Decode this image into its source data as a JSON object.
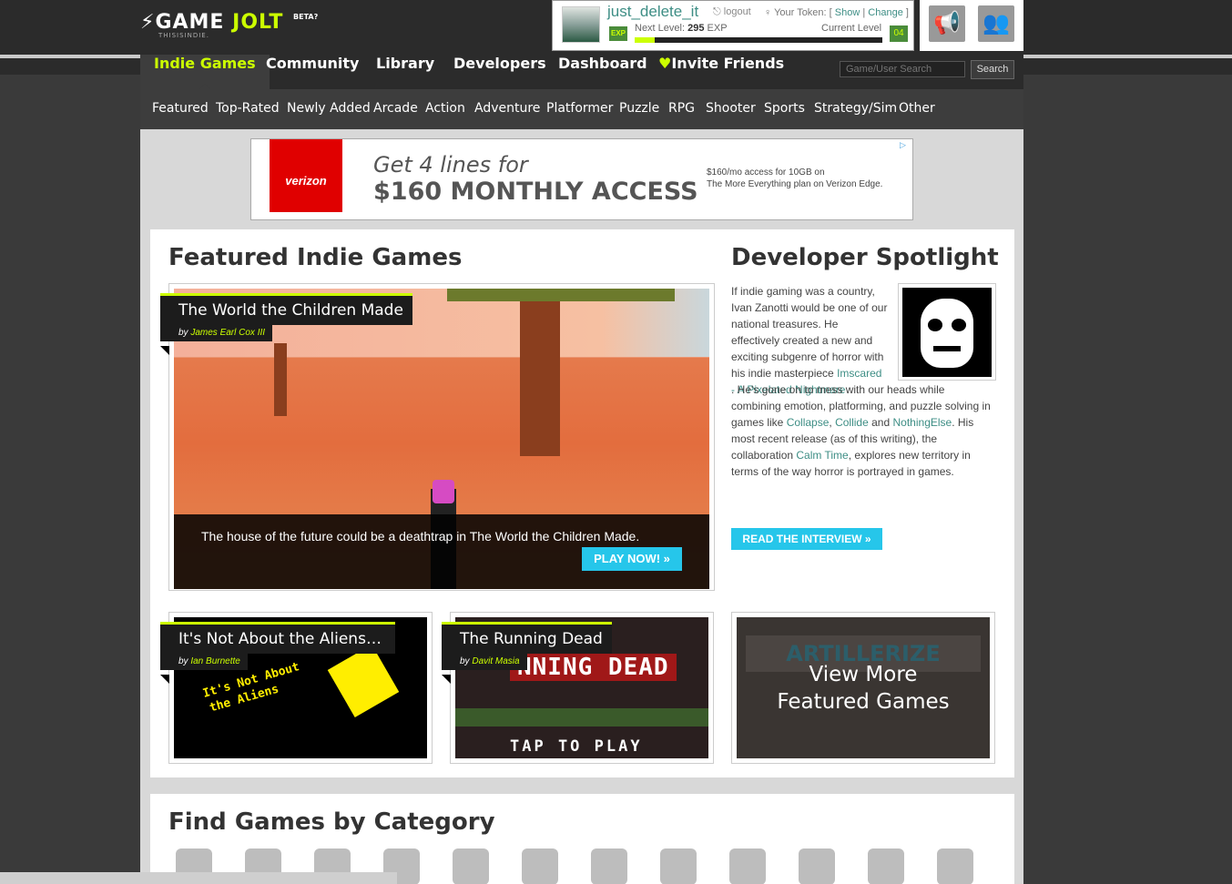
{
  "logo": {
    "text1": "GAME",
    "text2": "JOLT",
    "beta": "BETA?",
    "tagline": "THISISINDIE."
  },
  "user": {
    "name": "just_delete_it",
    "exp_label": "EXP",
    "logout": "logout",
    "token_label": "Your Token: [",
    "token_show": "Show",
    "token_sep": "|",
    "token_change": "Change",
    "token_end": "]",
    "next_level_label": "Next Level:",
    "next_level_exp": "295",
    "next_level_unit": "EXP",
    "current_level_label": "Current Level",
    "current_level": "04",
    "progress": 0.08
  },
  "nav": {
    "items": [
      "Indie Games",
      "Community",
      "Library",
      "Developers",
      "Dashboard",
      "Invite Friends"
    ],
    "search_placeholder": "Game/User Search",
    "search_button": "Search"
  },
  "subnav": [
    "Featured",
    "Top-Rated",
    "Newly Added",
    "Arcade",
    "Action",
    "Adventure",
    "Platformer",
    "Puzzle",
    "RPG",
    "Shooter",
    "Sports",
    "Strategy/Sim",
    "Other"
  ],
  "ad": {
    "brand": "verizon",
    "line1": "Get 4 lines for",
    "line2": "$160 MONTHLY ACCESS",
    "small1": "$160/mo access for 10GB on",
    "small2": "The More Everything plan on Verizon Edge."
  },
  "featured": {
    "heading": "Featured Indie Games",
    "main": {
      "title": "The World the Children Made",
      "by": "by",
      "author": "James Earl Cox III",
      "caption": "The house of the future could be a deathtrap in The World the Children Made.",
      "play": "PLAY NOW! »"
    },
    "tiles": [
      {
        "title": "It's Not About the Aliens (…",
        "by": "by",
        "author": "Ian Burnette",
        "art_line1": "It's Not About",
        "art_line2": "the Aliens"
      },
      {
        "title": "The Running Dead",
        "by": "by",
        "author": "Davit Masia",
        "art_title": "NNING DEAD",
        "art_tap": "TAP TO PLAY"
      },
      {
        "art": "ARTILLERIZE",
        "line1": "View More",
        "line2": "Featured Games"
      }
    ]
  },
  "spotlight": {
    "heading": "Developer Spotlight",
    "p1": "If indie gaming was a country, Ivan Zanotti would be one of our national treasures. He effectively created a new and exciting subgenre of horror with his indie masterpiece",
    "link1": "Imscared - A Pixelated Nightmare",
    "p2": ". He's gone on to mess with our heads while combining emotion, platforming, and puzzle solving in games like",
    "link2": "Collapse",
    "comma": ",",
    "link3": "Collide",
    "and": "and",
    "link4": "NothingElse",
    "p3": ". His most recent release (as of this writing), the collaboration",
    "link5": "Calm Time",
    "p4": ", explores new territory in terms of the way horror is portrayed in games.",
    "read": "READ THE INTERVIEW »"
  },
  "categories": {
    "heading": "Find Games by Category"
  }
}
